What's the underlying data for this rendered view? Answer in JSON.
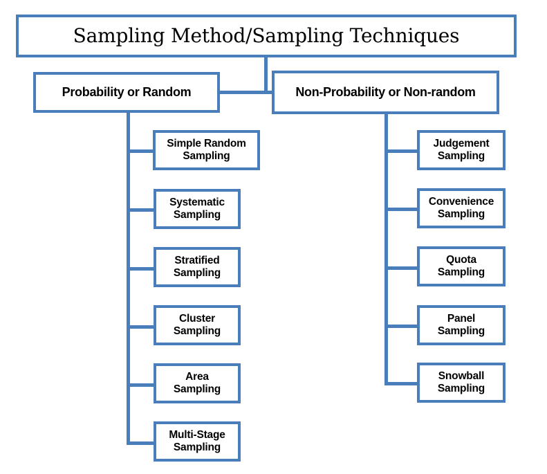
{
  "diagram": {
    "title": "Sampling Method/Sampling Techniques",
    "accent_color": "#4a7ebb",
    "background_color": "#ffffff",
    "text_color": "#000000",
    "branches": [
      {
        "id": "probability",
        "label": "Probability or Random",
        "children": [
          {
            "label": "Simple Random\nSampling"
          },
          {
            "label": "Systematic\nSampling"
          },
          {
            "label": "Stratified\nSampling"
          },
          {
            "label": "Cluster\nSampling"
          },
          {
            "label": "Area\nSampling"
          },
          {
            "label": "Multi-Stage\nSampling"
          }
        ]
      },
      {
        "id": "non-probability",
        "label": "Non-Probability or Non-random",
        "children": [
          {
            "label": "Judgement\nSampling"
          },
          {
            "label": "Convenience\nSampling"
          },
          {
            "label": "Quota\nSampling"
          },
          {
            "label": "Panel\nSampling"
          },
          {
            "label": "Snowball\nSampling"
          }
        ]
      }
    ]
  }
}
